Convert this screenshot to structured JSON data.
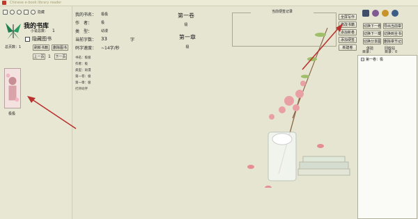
{
  "window": {
    "title": "Chinese e-book library reader"
  },
  "toolbar": {
    "icon_names": [
      "book-icon",
      "gear-icon",
      "settings-icon",
      "grid-icon",
      "refresh-icon"
    ],
    "more_label": "隐藏"
  },
  "library": {
    "title": "我的书库",
    "count_label": "小说总数：",
    "count_value": "1",
    "hide_label": "隐藏图书",
    "page_label": "总页数：",
    "page_value": "1",
    "refresh_btn": "刷新书籍",
    "delete_btn": "删除图书",
    "prev_btn": "上一页",
    "page_num": "1",
    "next_btn": "下一页",
    "book_name": "极极"
  },
  "book_info": {
    "name_label": "我的书名：",
    "name_value": "极极",
    "author_label": "作　者：",
    "author_value": "极",
    "type_label": "类　型：",
    "type_value": "幼漫",
    "words_label": "当前字数：",
    "words_value": "33",
    "words_unit": "字",
    "speed_label": "码字速度：",
    "speed_value": "~14字/秒",
    "detail_lines": [
      "书名：极极",
      "作者：极",
      "类型：幼漫",
      "第一卷：极",
      "第一章：极",
      "打开码字"
    ]
  },
  "reading": {
    "volume": "第一卷",
    "volume_sub": "极",
    "chapter": "第一章",
    "chapter_sub": "极"
  },
  "bookmarks": {
    "title": "当前便签记录"
  },
  "buttons": {
    "b1": "全屏写作",
    "b2": "修改书籍",
    "b3": "添加新卷",
    "b4": "添加便签",
    "b5": "新建卷",
    "c1": "切换下一卷",
    "c2": "切换下一章",
    "c3": "切换分享图",
    "c4": "导出当前章节",
    "c5": "切换到全书名字",
    "c6": "删除章节记录"
  },
  "right_labels": {
    "info1": "体验",
    "info2": "目录：",
    "info3": "回收站",
    "info4": "目录：0"
  },
  "tree": {
    "item": "第一卷：极"
  },
  "colors": {
    "accent": "#c0392b",
    "panel": "#e8e7d3"
  }
}
